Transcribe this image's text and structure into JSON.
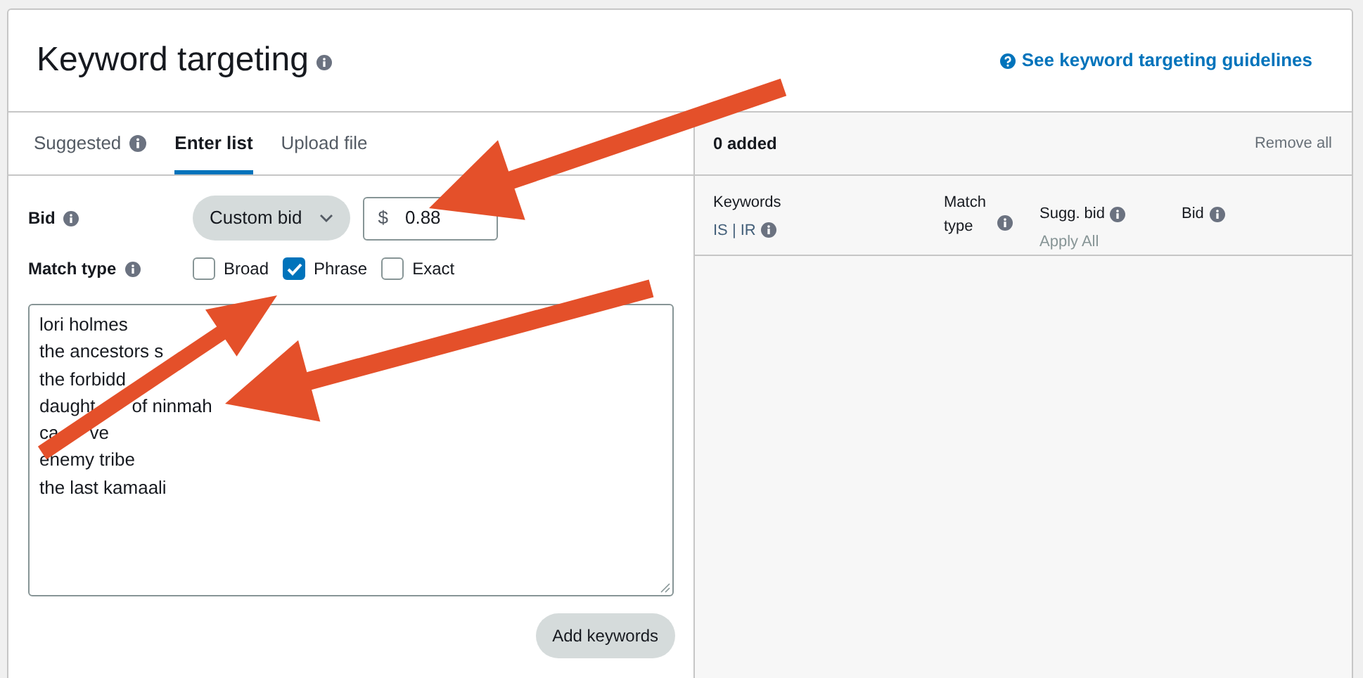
{
  "header": {
    "title": "Keyword targeting",
    "guidelines_link": "See keyword targeting guidelines"
  },
  "tabs": [
    {
      "label": "Suggested",
      "info": true,
      "selected": false
    },
    {
      "label": "Enter list",
      "info": false,
      "selected": true
    },
    {
      "label": "Upload file",
      "info": false,
      "selected": false
    }
  ],
  "bid": {
    "label": "Bid",
    "mode": "Custom bid",
    "currency": "$",
    "value": "0.88"
  },
  "match_type": {
    "label": "Match type",
    "options": [
      {
        "label": "Broad",
        "checked": false
      },
      {
        "label": "Phrase",
        "checked": true
      },
      {
        "label": "Exact",
        "checked": false
      }
    ]
  },
  "keywords": [
    [
      "lori holmes"
    ],
    [
      "the ancestors s"
    ],
    [
      "the forbidd"
    ],
    [
      "daught",
      "of ninmah"
    ],
    [
      "ca",
      "ve"
    ],
    [
      "enemy tribe"
    ],
    [
      "the last kamaali"
    ]
  ],
  "add_button": "Add keywords",
  "added_panel": {
    "count": "0 added",
    "remove_all": "Remove all",
    "columns": [
      {
        "label": "Keywords",
        "sub": "IS | IR",
        "kind": "metrics"
      },
      {
        "label": "Match type",
        "kind": "wrapped"
      },
      {
        "label": "Sugg. bid",
        "sub": "Apply All",
        "kind": "action"
      },
      {
        "label": "Bid",
        "kind": "plain"
      }
    ]
  }
}
